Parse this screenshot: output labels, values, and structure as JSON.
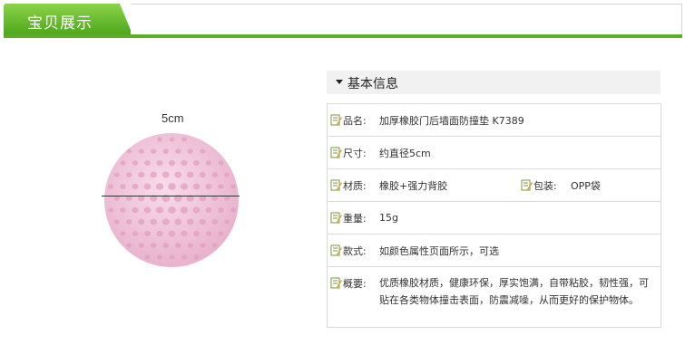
{
  "header": {
    "title": "宝贝展示"
  },
  "image": {
    "dimension_label": "5cm"
  },
  "info": {
    "title": "基本信息",
    "rows": [
      {
        "label": "品名:",
        "value": "加厚橡胶门后墙面防撞垫 K7389"
      },
      {
        "label": "尺寸:",
        "value": "约直径5cm"
      },
      {
        "label": "材质:",
        "value": "橡胶+强力背胶",
        "label2": "包装:",
        "value2": "OPP袋"
      },
      {
        "label": "重量:",
        "value": "15g"
      },
      {
        "label": "款式:",
        "value": "如颜色属性页面所示，可选"
      },
      {
        "label": "概要:",
        "value": "优质橡胶材质，健康环保，厚实饱满，自带粘胶，韧性强，可贴在各类物体撞击表面，防震减噪，从而更好的保护物体。"
      }
    ]
  },
  "colors": {
    "accent": "#5aad24",
    "ball": "#f2c6da"
  },
  "icons": {
    "row_icon": "note-pencil-icon"
  }
}
